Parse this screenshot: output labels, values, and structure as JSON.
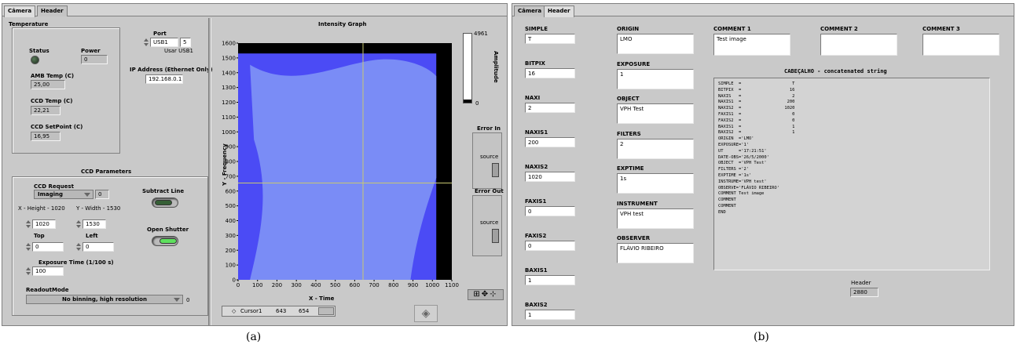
{
  "a": {
    "tabs": [
      "Câmera",
      "Header"
    ],
    "temperature": {
      "title": "Temperature",
      "status_label": "Status",
      "power_label": "Power",
      "power_value": "0",
      "amb_label": "AMB Temp (C)",
      "amb_value": "25,00",
      "ccd_label": "CCD Temp (C)",
      "ccd_value": "22,21",
      "setpoint_label": "CCD SetPoint (C)",
      "setpoint_value": "16,95"
    },
    "port": {
      "label": "Port",
      "value": "USB1",
      "number": "5",
      "use_label": "Usar USB1"
    },
    "ip": {
      "label": "IP Address (Ethernet Only)",
      "value": "192.168.0.1"
    },
    "ccd_params": {
      "title": "CCD Parameters",
      "request_label": "CCD Request",
      "request_value": "Imaging",
      "request_index": "0",
      "height_label": "X - Height - 1020",
      "width_label": "Y - Width - 1530",
      "height_value": "1020",
      "width_value": "1530",
      "top_label": "Top",
      "top_value": "0",
      "left_label": "Left",
      "left_value": "0",
      "subtract_label": "Subtract Line",
      "shutter_label": "Open Shutter",
      "exposure_label": "Exposure Time (1/100 s)",
      "exposure_value": "100",
      "readout_label": "ReadoutMode",
      "readout_value": "No binning, high resolution",
      "readout_index": "0"
    },
    "graph": {
      "title": "Intensity Graph",
      "x_label": "X - Time",
      "y_label": "Y - Frequency",
      "amp_label": "Amplitude",
      "amp_max": "4961",
      "amp_min": "0",
      "cursor_name": "Cursor1",
      "cursor_x": "643",
      "cursor_y": "654"
    },
    "error_in_label": "Error In",
    "error_out_label": "Error Out",
    "source_label": "source",
    "caption": "(a)"
  },
  "chart_data": {
    "type": "heatmap",
    "title": "Intensity Graph",
    "xlabel": "X - Time",
    "ylabel": "Y - Frequency",
    "xlim": [
      0,
      1100
    ],
    "ylim": [
      0,
      1600
    ],
    "x_ticks": [
      0,
      100,
      200,
      300,
      400,
      500,
      600,
      700,
      800,
      900,
      1000,
      1100
    ],
    "y_ticks": [
      0,
      100,
      200,
      300,
      400,
      500,
      600,
      700,
      800,
      900,
      1000,
      1100,
      1200,
      1300,
      1400,
      1500,
      1600
    ],
    "image_extent": {
      "x": [
        0,
        1020
      ],
      "y": [
        0,
        1530
      ]
    },
    "colorbar": {
      "label": "Amplitude",
      "min": 0,
      "max": 4961
    },
    "cursor": {
      "name": "Cursor1",
      "x": 643,
      "y": 654
    },
    "colors": {
      "low": "#4b4bf5",
      "high": "#7a8cf6",
      "outside": "#000000"
    }
  },
  "b": {
    "tabs": [
      "Câmera",
      "Header"
    ],
    "fields": [
      {
        "label": "SIMPLE",
        "value": "T"
      },
      {
        "label": "BITPIX",
        "value": "16"
      },
      {
        "label": "NAXI",
        "value": "2"
      },
      {
        "label": "NAXIS1",
        "value": "200"
      },
      {
        "label": "NAXIS2",
        "value": "1020"
      },
      {
        "label": "FAXIS1",
        "value": "0"
      },
      {
        "label": "FAXIS2",
        "value": "0"
      },
      {
        "label": "BAXIS1",
        "value": "1"
      },
      {
        "label": "BAXIS2",
        "value": "1"
      }
    ],
    "fields2": [
      {
        "label": "ORIGIN",
        "value": "LMO"
      },
      {
        "label": "EXPOSURE",
        "value": "1"
      },
      {
        "label": "OBJECT",
        "value": "VPH Test"
      },
      {
        "label": "FILTERS",
        "value": "2"
      },
      {
        "label": "EXPTIME",
        "value": "1s"
      },
      {
        "label": "INSTRUMENT",
        "value": "VPH test"
      },
      {
        "label": "OBSERVER",
        "value": "FLÁVIO RIBEIRO"
      }
    ],
    "comments": [
      {
        "label": "COMMENT 1",
        "value": "Test image"
      },
      {
        "label": "COMMENT 2",
        "value": ""
      },
      {
        "label": "COMMENT 3",
        "value": ""
      }
    ],
    "concat_label": "CABEÇALHO - concatenated string",
    "concat_text": "SIMPLE  =                    T\nBITPIX  =                   16\nNAXIS   =                    2\nNAXIS1  =                  200\nNAXIS2  =                 1020\nFAXIS1  =                    0\nFAXIS2  =                    0\nBAXIS1  =                    1\nBAXIS2  =                    1\nORIGIN  ='LMO'\nEXPOSURE='1'\nUT      ='17:21:51'\nDATE-OBS='26/5/2000'\nOBJECT  ='VPH Test'\nFILTERS ='2'\nEXPTIME ='1s'\nINSTRUME='VPH test'\nOBSERVE='FLÁVIO RIBEIRO'\nCOMMENT Test image\nCOMMENT\nCOMMENT\nEND",
    "header_label": "Header",
    "header_value": "2880",
    "caption": "(b)"
  }
}
